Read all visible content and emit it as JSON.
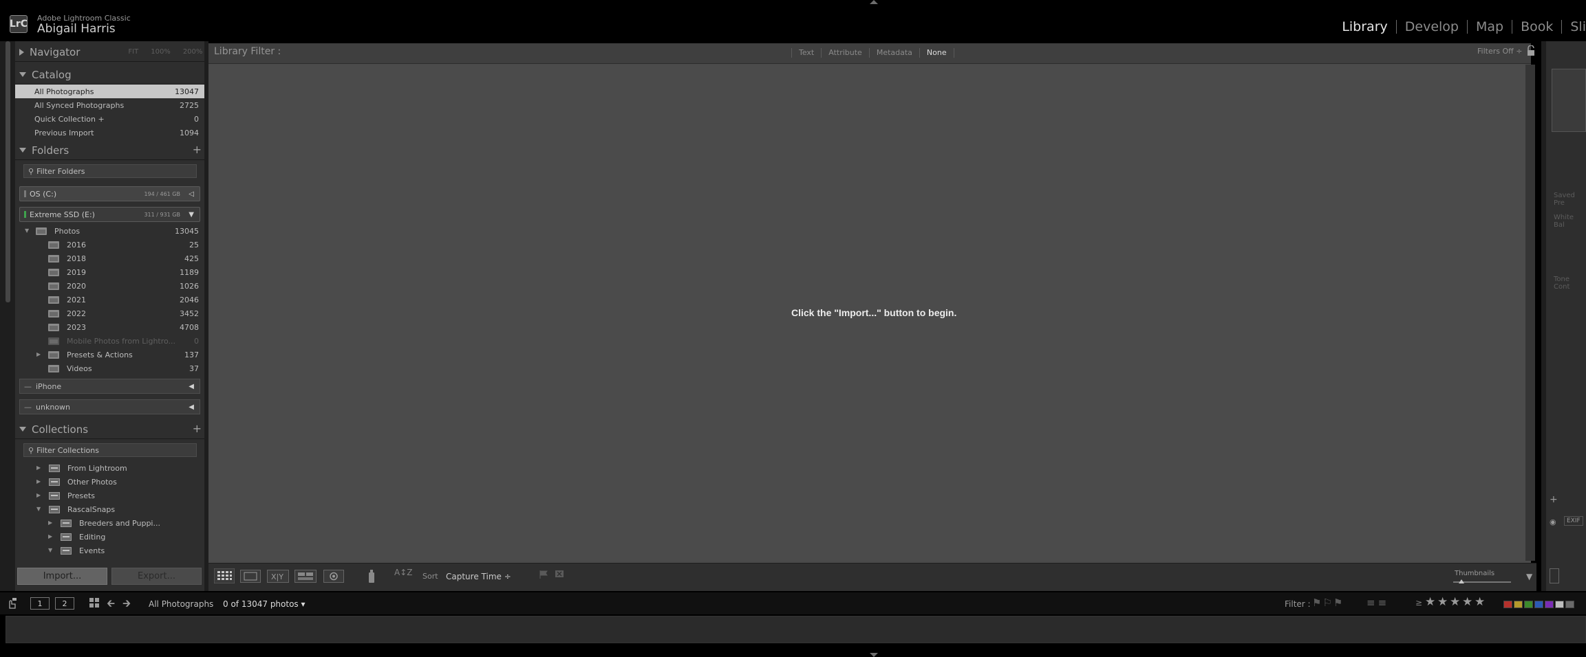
{
  "app": {
    "name": "Adobe Lightroom Classic",
    "logo_text": "LrC",
    "user": "Abigail Harris"
  },
  "modules": [
    {
      "label": "Library",
      "active": true
    },
    {
      "label": "Develop",
      "active": false
    },
    {
      "label": "Map",
      "active": false
    },
    {
      "label": "Book",
      "active": false
    },
    {
      "label": "Sli",
      "active": false
    }
  ],
  "navigator": {
    "title": "Navigator",
    "zoom_options": [
      "FIT",
      "100%",
      "200%"
    ]
  },
  "catalog": {
    "title": "Catalog",
    "items": [
      {
        "label": "All Photographs",
        "count": "13047",
        "selected": true
      },
      {
        "label": "All Synced Photographs",
        "count": "2725"
      },
      {
        "label": "Quick Collection  +",
        "count": "0"
      },
      {
        "label": "Previous Import",
        "count": "1094"
      }
    ]
  },
  "folders": {
    "title": "Folders",
    "add": "+",
    "filter_placeholder": "Filter Folders",
    "volumes": [
      {
        "label": "OS (C:)",
        "capacity": "194 / 461 GB"
      },
      {
        "label": "Extreme SSD (E:)",
        "capacity": "311 / 931 GB"
      }
    ],
    "root": {
      "label": "Photos",
      "count": "13045"
    },
    "items": [
      {
        "label": "2016",
        "count": "25"
      },
      {
        "label": "2018",
        "count": "425"
      },
      {
        "label": "2019",
        "count": "1189"
      },
      {
        "label": "2020",
        "count": "1026"
      },
      {
        "label": "2021",
        "count": "2046"
      },
      {
        "label": "2022",
        "count": "3452"
      },
      {
        "label": "2023",
        "count": "4708"
      },
      {
        "label": "Mobile Photos from Lightro...",
        "count": "0"
      },
      {
        "label": "Presets & Actions",
        "count": "137"
      },
      {
        "label": "Videos",
        "count": "37"
      }
    ],
    "devices": [
      {
        "label": "iPhone"
      },
      {
        "label": "unknown"
      }
    ]
  },
  "collections": {
    "title": "Collections",
    "add": "+",
    "filter_placeholder": "Filter Collections",
    "items": [
      {
        "label": "From Lightroom"
      },
      {
        "label": "Other Photos"
      },
      {
        "label": "Presets"
      },
      {
        "label": "RascalSnaps"
      },
      {
        "label": "Breeders and Puppi..."
      },
      {
        "label": "Editing"
      },
      {
        "label": "Events"
      }
    ]
  },
  "buttons": {
    "import": "Import...",
    "export": "Export..."
  },
  "library_filter": {
    "label": "Library Filter :",
    "options": [
      {
        "label": "Text"
      },
      {
        "label": "Attribute"
      },
      {
        "label": "Metadata"
      },
      {
        "label": "None",
        "active": true
      }
    ],
    "preset": "Filters Off ÷"
  },
  "grid": {
    "empty_message": "Click the \"Import...\" button to begin."
  },
  "toolbar": {
    "sort_label": "Sort",
    "sort_value": "Capture Time ÷",
    "sort_az": "A↕Z",
    "thumbnails_label": "Thumbnails",
    "thumbnail_size": 0.14
  },
  "right_panel": {
    "labels": [
      "Saved Pre",
      "White Bal",
      "Tone Cont",
      "EXIF"
    ]
  },
  "filmstrip_bar": {
    "screen1": "1",
    "screen2": "2",
    "source": "All Photographs",
    "count_text": "0 of 13047 photos ▾",
    "filter_label": "Filter :",
    "colors": [
      "#b5312c",
      "#b59a2c",
      "#3d8a2c",
      "#2c5ab5",
      "#7a2cb5",
      "#bdbdbd",
      "#6a6a6a"
    ]
  }
}
